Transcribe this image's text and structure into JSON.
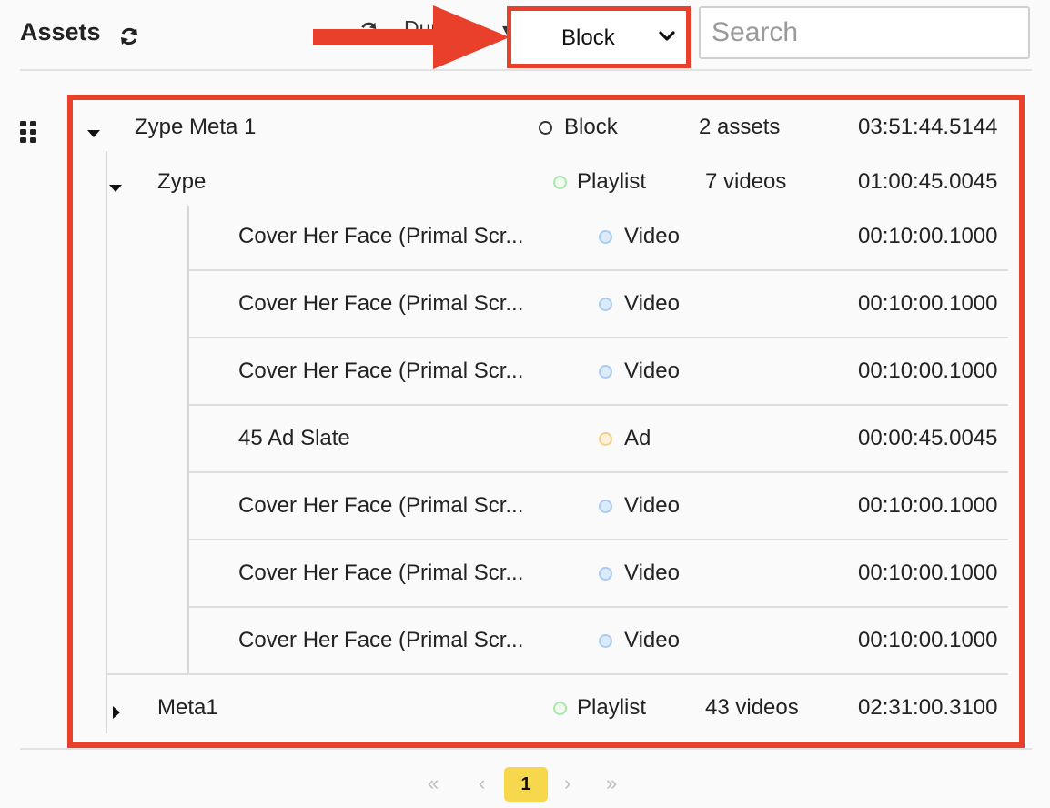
{
  "header": {
    "title": "Assets",
    "sort_label": "Duration",
    "view_dropdown_value": "Block",
    "search_placeholder": "Search"
  },
  "tree": {
    "root": {
      "name": "Zype Meta 1",
      "type": "Block",
      "count": "2 assets",
      "duration": "03:51:44.5144"
    },
    "child1": {
      "name": "Zype",
      "type": "Playlist",
      "count": "7 videos",
      "duration": "01:00:45.0045"
    },
    "videos": [
      {
        "name": "Cover Her Face (Primal Scr...",
        "type": "Video",
        "duration": "00:10:00.1000"
      },
      {
        "name": "Cover Her Face (Primal Scr...",
        "type": "Video",
        "duration": "00:10:00.1000"
      },
      {
        "name": "Cover Her Face (Primal Scr...",
        "type": "Video",
        "duration": "00:10:00.1000"
      },
      {
        "name": "45 Ad Slate",
        "type": "Ad",
        "duration": "00:00:45.0045"
      },
      {
        "name": "Cover Her Face (Primal Scr...",
        "type": "Video",
        "duration": "00:10:00.1000"
      },
      {
        "name": "Cover Her Face (Primal Scr...",
        "type": "Video",
        "duration": "00:10:00.1000"
      },
      {
        "name": "Cover Her Face (Primal Scr...",
        "type": "Video",
        "duration": "00:10:00.1000"
      }
    ],
    "child2": {
      "name": "Meta1",
      "type": "Playlist",
      "count": "43 videos",
      "duration": "02:31:00.3100"
    }
  },
  "pagination": {
    "first": "«",
    "prev": "‹",
    "current": "1",
    "next": "›",
    "last": "»"
  },
  "colors": {
    "highlight": "#e8402a",
    "video_dot": "#a9cdf2",
    "ad_dot": "#f6cf86",
    "playlist_dot": "#a9e8ac",
    "page_active": "#f7d84c"
  }
}
